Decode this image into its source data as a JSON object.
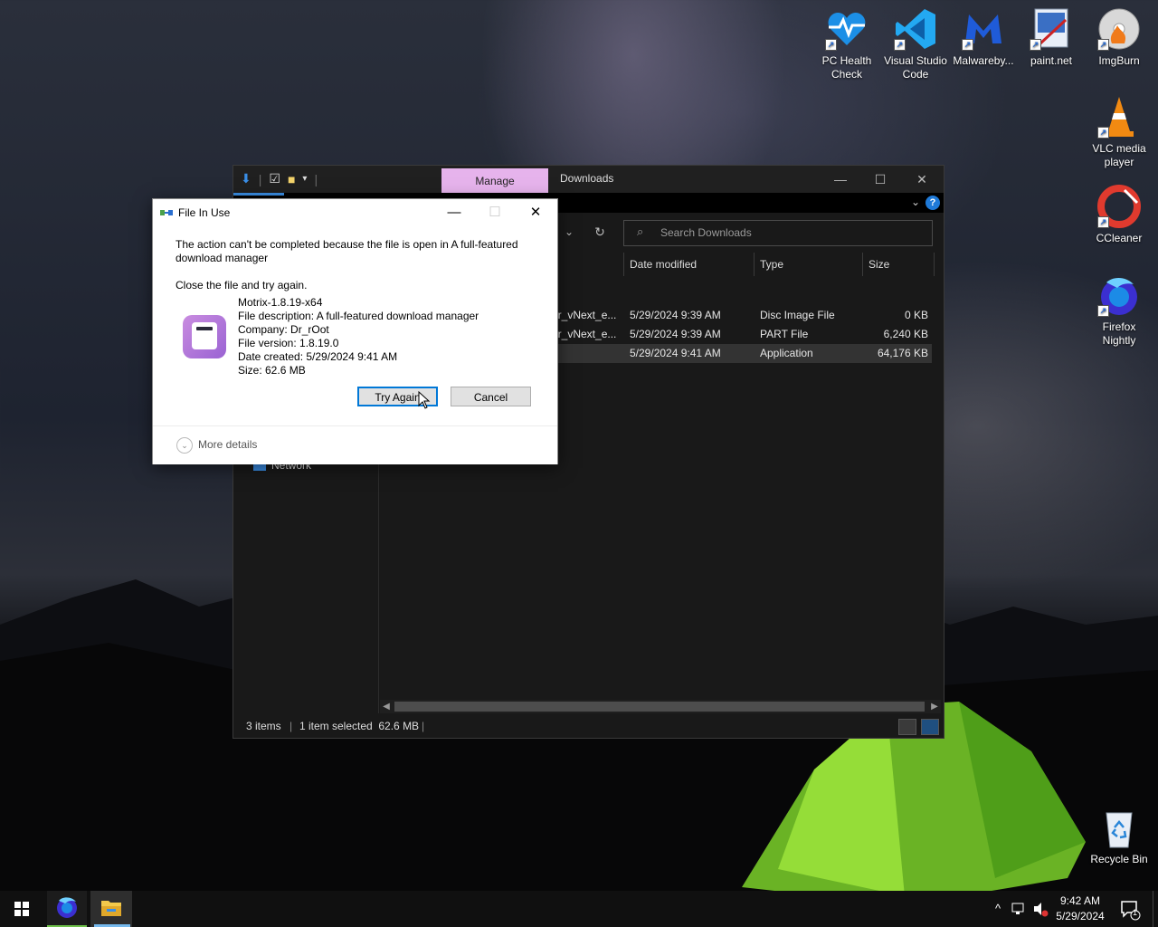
{
  "desktop": {
    "icons": [
      {
        "label": "PC Health Check",
        "icon": "heart-pulse-icon"
      },
      {
        "label": "Visual Studio Code",
        "icon": "vscode-icon"
      },
      {
        "label": "Malwareby...",
        "icon": "malwarebytes-icon"
      },
      {
        "label": "paint.net",
        "icon": "paintnet-icon"
      },
      {
        "label": "ImgBurn",
        "icon": "imgburn-icon"
      },
      {
        "label": "VLC media player",
        "icon": "vlc-cone-icon"
      },
      {
        "label": "CCleaner",
        "icon": "ccleaner-icon"
      },
      {
        "label": "Firefox Nightly",
        "icon": "firefox-nightly-icon"
      },
      {
        "label": "Recycle Bin",
        "icon": "recycle-bin-icon"
      }
    ]
  },
  "explorer": {
    "manage_tab": "Manage",
    "title": "Downloads",
    "search_placeholder": "Search Downloads",
    "columns": {
      "date": "Date modified",
      "type": "Type",
      "size": "Size"
    },
    "rows": [
      {
        "name": "er_vNext_e...",
        "date": "5/29/2024 9:39 AM",
        "type": "Disc Image File",
        "size": "0 KB",
        "selected": false
      },
      {
        "name": "er_vNext_e...",
        "date": "5/29/2024 9:39 AM",
        "type": "PART File",
        "size": "6,240 KB",
        "selected": false
      },
      {
        "name": "",
        "date": "5/29/2024 9:41 AM",
        "type": "Application",
        "size": "64,176 KB",
        "selected": true
      }
    ],
    "nav": {
      "network": "Network"
    },
    "status": {
      "items": "3 items",
      "selected": "1 item selected  62.6 MB"
    }
  },
  "dialog": {
    "title": "File In Use",
    "message": "The action can't be completed because the file is open in A full-featured download manager",
    "instruction": "Close the file and try again.",
    "file": {
      "name": "Motrix-1.8.19-x64",
      "description": "File description: A full-featured download manager",
      "company": "Company: Dr_rOot",
      "version": "File version: 1.8.19.0",
      "created": "Date created: 5/29/2024 9:41 AM",
      "size": "Size: 62.6 MB"
    },
    "try_again": "Try Again",
    "cancel": "Cancel",
    "more_details": "More details"
  },
  "taskbar": {
    "time": "9:42 AM",
    "date": "5/29/2024",
    "notification_count": "1"
  },
  "colors": {
    "manage_tab": "#e6b3ec",
    "accent": "#0078d7"
  }
}
